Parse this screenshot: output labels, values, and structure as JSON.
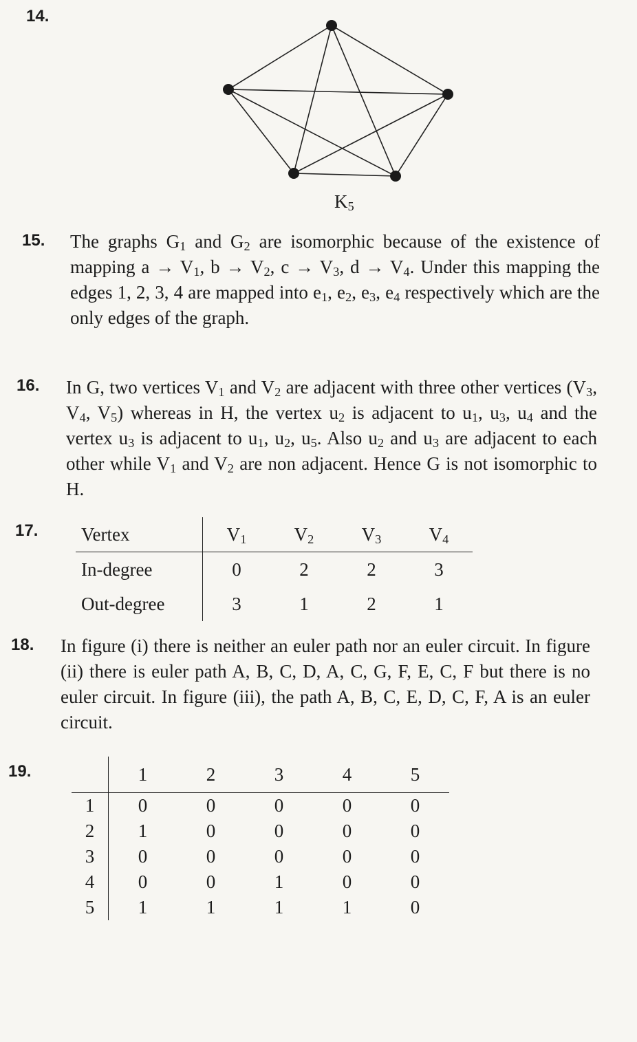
{
  "q14": {
    "number": "14.",
    "caption_base": "K",
    "caption_sub": "5"
  },
  "q15": {
    "number": "15.",
    "t1": "The graphs G",
    "s1": "1",
    "t2": " and G",
    "s2": "2",
    "t3": " are isomorphic because of the existence of mapping a → V",
    "s3": "1",
    "t4": ", b → V",
    "s4": "2",
    "t5": ", c → V",
    "s5": "3",
    "t6": ", d → V",
    "s6": "4",
    "t7": ". Under this mapping the edges 1, 2, 3, 4 are mapped into e",
    "s7": "1",
    "t8": ", e",
    "s8": "2",
    "t9": ", e",
    "s9": "3",
    "t10": ", e",
    "s10": "4",
    "t11": " respectively which are the only edges of the graph."
  },
  "q16": {
    "number": "16.",
    "t1": "In G, two vertices V",
    "s1": "1",
    "t2": " and V",
    "s2": "2",
    "t3": " are adjacent with three other vertices (V",
    "s3": "3",
    "t4": ", V",
    "s4": "4",
    "t5": ", V",
    "s5": "5",
    "t6": ") whereas in H, the vertex u",
    "s6": "2",
    "t7": " is adjacent to u",
    "s7": "1",
    "t8": ", u",
    "s8": "3",
    "t9": ", u",
    "s9": "4",
    "t10": " and the vertex u",
    "s10": "3",
    "t11": " is adjacent to u",
    "s11": "1",
    "t12": ", u",
    "s12": "2",
    "t13": ", u",
    "s13": "5",
    "t14": ". Also u",
    "s14": "2",
    "t15": " and u",
    "s15": "3",
    "t16": " are adjacent to each other while V",
    "s16": "1",
    "t17": " and V",
    "s17": "2",
    "t18": " are non adjacent. Hence G is not isomorphic to H."
  },
  "q17": {
    "number": "17.",
    "corner": "Vertex",
    "col_base": "V",
    "col_subs": [
      "1",
      "2",
      "3",
      "4"
    ],
    "rows": [
      {
        "label": "In-degree",
        "values": [
          "0",
          "2",
          "2",
          "3"
        ]
      },
      {
        "label": "Out-degree",
        "values": [
          "3",
          "1",
          "2",
          "1"
        ]
      }
    ]
  },
  "q18": {
    "number": "18.",
    "text": "In figure (i) there is neither an euler path nor an euler circuit. In figure (ii) there is euler path A, B, C, D, A, C, G, F, E, C, F but there is no euler circuit. In figure (iii), the path A, B, C, E, D, C, F, A is an euler circuit."
  },
  "q19": {
    "number": "19.",
    "headers": [
      "1",
      "2",
      "3",
      "4",
      "5"
    ],
    "rows": [
      {
        "label": "1",
        "values": [
          "0",
          "0",
          "0",
          "0",
          "0"
        ]
      },
      {
        "label": "2",
        "values": [
          "1",
          "0",
          "0",
          "0",
          "0"
        ]
      },
      {
        "label": "3",
        "values": [
          "0",
          "0",
          "0",
          "0",
          "0"
        ]
      },
      {
        "label": "4",
        "values": [
          "0",
          "0",
          "1",
          "0",
          "0"
        ]
      },
      {
        "label": "5",
        "values": [
          "1",
          "1",
          "1",
          "1",
          "0"
        ]
      }
    ]
  }
}
